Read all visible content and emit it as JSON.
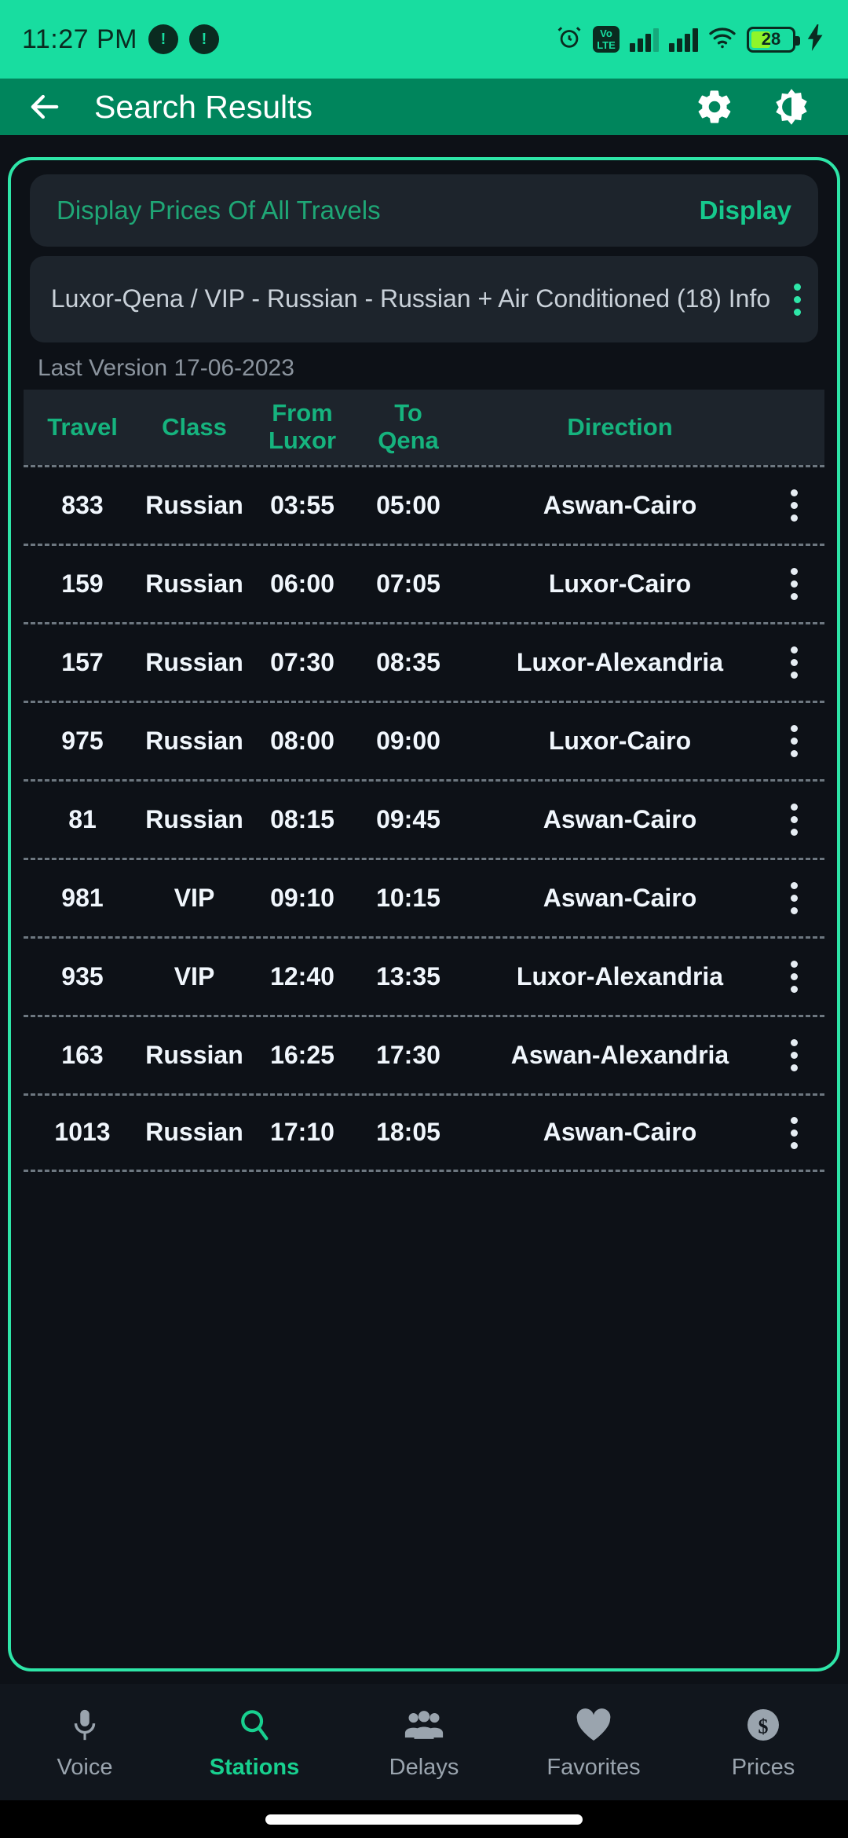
{
  "status_bar": {
    "time": "11:27 PM",
    "dnd_badges": [
      "dnd-icon",
      "dnd-icon"
    ],
    "icons": [
      "alarm-icon",
      "volte-icon",
      "signal-bars-sim1",
      "signal-bars-sim2",
      "wifi-icon",
      "battery-icon",
      "charging-bolt-icon"
    ],
    "volte_top": "Vo",
    "volte_bottom": "LTE",
    "battery_percent": "28",
    "colors": {
      "background": "#18dda0",
      "foreground": "#0a2b20",
      "battery_fill": "#8ff52a"
    }
  },
  "app_bar": {
    "back_icon": "arrow-left-icon",
    "title": "Search Results",
    "settings_icon": "gear-icon",
    "theme_icon": "brightness-contrast-icon",
    "color": "#00855c"
  },
  "prices_banner": {
    "label": "Display Prices Of All Travels",
    "action": "Display"
  },
  "route_header": {
    "text": "Luxor-Qena / VIP - Russian - Russian + Air Conditioned (18) Info",
    "menu_icon": "kebab-menu-icon"
  },
  "last_version": "Last Version 17-06-2023",
  "table": {
    "columns": [
      {
        "key": "travel",
        "label": "Travel",
        "sub": ""
      },
      {
        "key": "class",
        "label": "Class",
        "sub": ""
      },
      {
        "key": "from",
        "label": "From",
        "sub": "Luxor"
      },
      {
        "key": "to",
        "label": "To",
        "sub": "Qena"
      },
      {
        "key": "direction",
        "label": "Direction",
        "sub": ""
      }
    ],
    "rows": [
      {
        "travel": "833",
        "class": "Russian",
        "from": "03:55",
        "to": "05:00",
        "direction": "Aswan-Cairo"
      },
      {
        "travel": "159",
        "class": "Russian",
        "from": "06:00",
        "to": "07:05",
        "direction": "Luxor-Cairo"
      },
      {
        "travel": "157",
        "class": "Russian",
        "from": "07:30",
        "to": "08:35",
        "direction": "Luxor-Alexandria"
      },
      {
        "travel": "975",
        "class": "Russian",
        "from": "08:00",
        "to": "09:00",
        "direction": "Luxor-Cairo"
      },
      {
        "travel": "81",
        "class": "Russian",
        "from": "08:15",
        "to": "09:45",
        "direction": "Aswan-Cairo"
      },
      {
        "travel": "981",
        "class": "VIP",
        "from": "09:10",
        "to": "10:15",
        "direction": "Aswan-Cairo"
      },
      {
        "travel": "935",
        "class": "VIP",
        "from": "12:40",
        "to": "13:35",
        "direction": "Luxor-Alexandria"
      },
      {
        "travel": "163",
        "class": "Russian",
        "from": "16:25",
        "to": "17:30",
        "direction": "Aswan-Alexandria"
      },
      {
        "travel": "1013",
        "class": "Russian",
        "from": "17:10",
        "to": "18:05",
        "direction": "Aswan-Cairo"
      }
    ],
    "row_menu_icon": "kebab-menu-icon"
  },
  "bottom_nav": {
    "items": [
      {
        "label": "Voice",
        "icon": "microphone-icon",
        "active": false
      },
      {
        "label": "Stations",
        "icon": "search-icon",
        "active": true
      },
      {
        "label": "Delays",
        "icon": "people-group-icon",
        "active": false
      },
      {
        "label": "Favorites",
        "icon": "heart-icon",
        "active": false
      },
      {
        "label": "Prices",
        "icon": "dollar-circle-icon",
        "active": false
      }
    ],
    "active_color": "#18d08f",
    "inactive_color": "#9aa4ae"
  },
  "theme": {
    "accent": "#2ee6a8",
    "surface": "#1d242c",
    "background": "#0d1117"
  }
}
